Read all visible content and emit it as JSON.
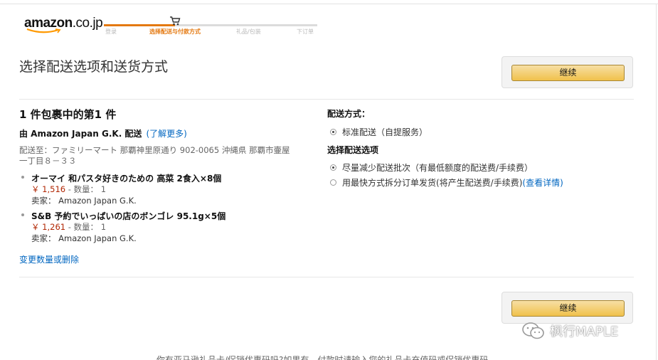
{
  "header": {
    "logo_text": "amazon",
    "logo_tld": ".co.jp",
    "steps": [
      {
        "label": "登录",
        "active": false
      },
      {
        "label": "选择配送与付款方式",
        "active": true
      },
      {
        "label": "礼品/包装",
        "active": false
      },
      {
        "label": "下订单",
        "active": false
      }
    ]
  },
  "page": {
    "title": "选择配送选项和送货方式",
    "continue_label": "继续",
    "continue_label_bottom": "继续"
  },
  "package": {
    "title": "1 件包裹中的第1 件",
    "ship_by": "由 Amazon Japan G.K. 配送",
    "learn_more": "(了解更多)",
    "address": "配送至：ファミリーマート 那覇神里原通り 902-0065 沖縄県 那覇市壷屋一丁目８－３３",
    "items": [
      {
        "name": "オーマイ 和パスタ好きのための 高菜 2食入×8個",
        "price": "￥ 1,516",
        "qty": " - 数量： 1",
        "seller": "卖家：  Amazon Japan G.K."
      },
      {
        "name": "S&B 予約でいっぱいの店のボンゴレ 95.1g×5個",
        "price": "￥ 1,261",
        "qty": " - 数量： 1",
        "seller": "卖家：  Amazon Japan G.K."
      }
    ],
    "change_link": "变更数量或删除"
  },
  "shipping": {
    "method_title": "配送方式：",
    "method_option": "标准配送（自提服务）",
    "options_title": "选择配送选项",
    "option_1": "尽量减少配送批次（有最低额度的配送费/手续费）",
    "option_2": "用最快方式拆分订单发货(将产生配送费/手续费)",
    "option_2_link": "(查看详情)"
  },
  "footer": {
    "text": "你有亚马逊礼品卡/促销优惠码吗?如果有，付款时请输入您的礼品卡充值码或促销优惠码。"
  },
  "watermark": {
    "text": "枫行MAPLE"
  },
  "colors": {
    "active_step": "#e47911",
    "link": "#0066c0",
    "price": "#b12704",
    "button_top": "#f7dfa5",
    "button_bottom": "#f0c14b"
  }
}
